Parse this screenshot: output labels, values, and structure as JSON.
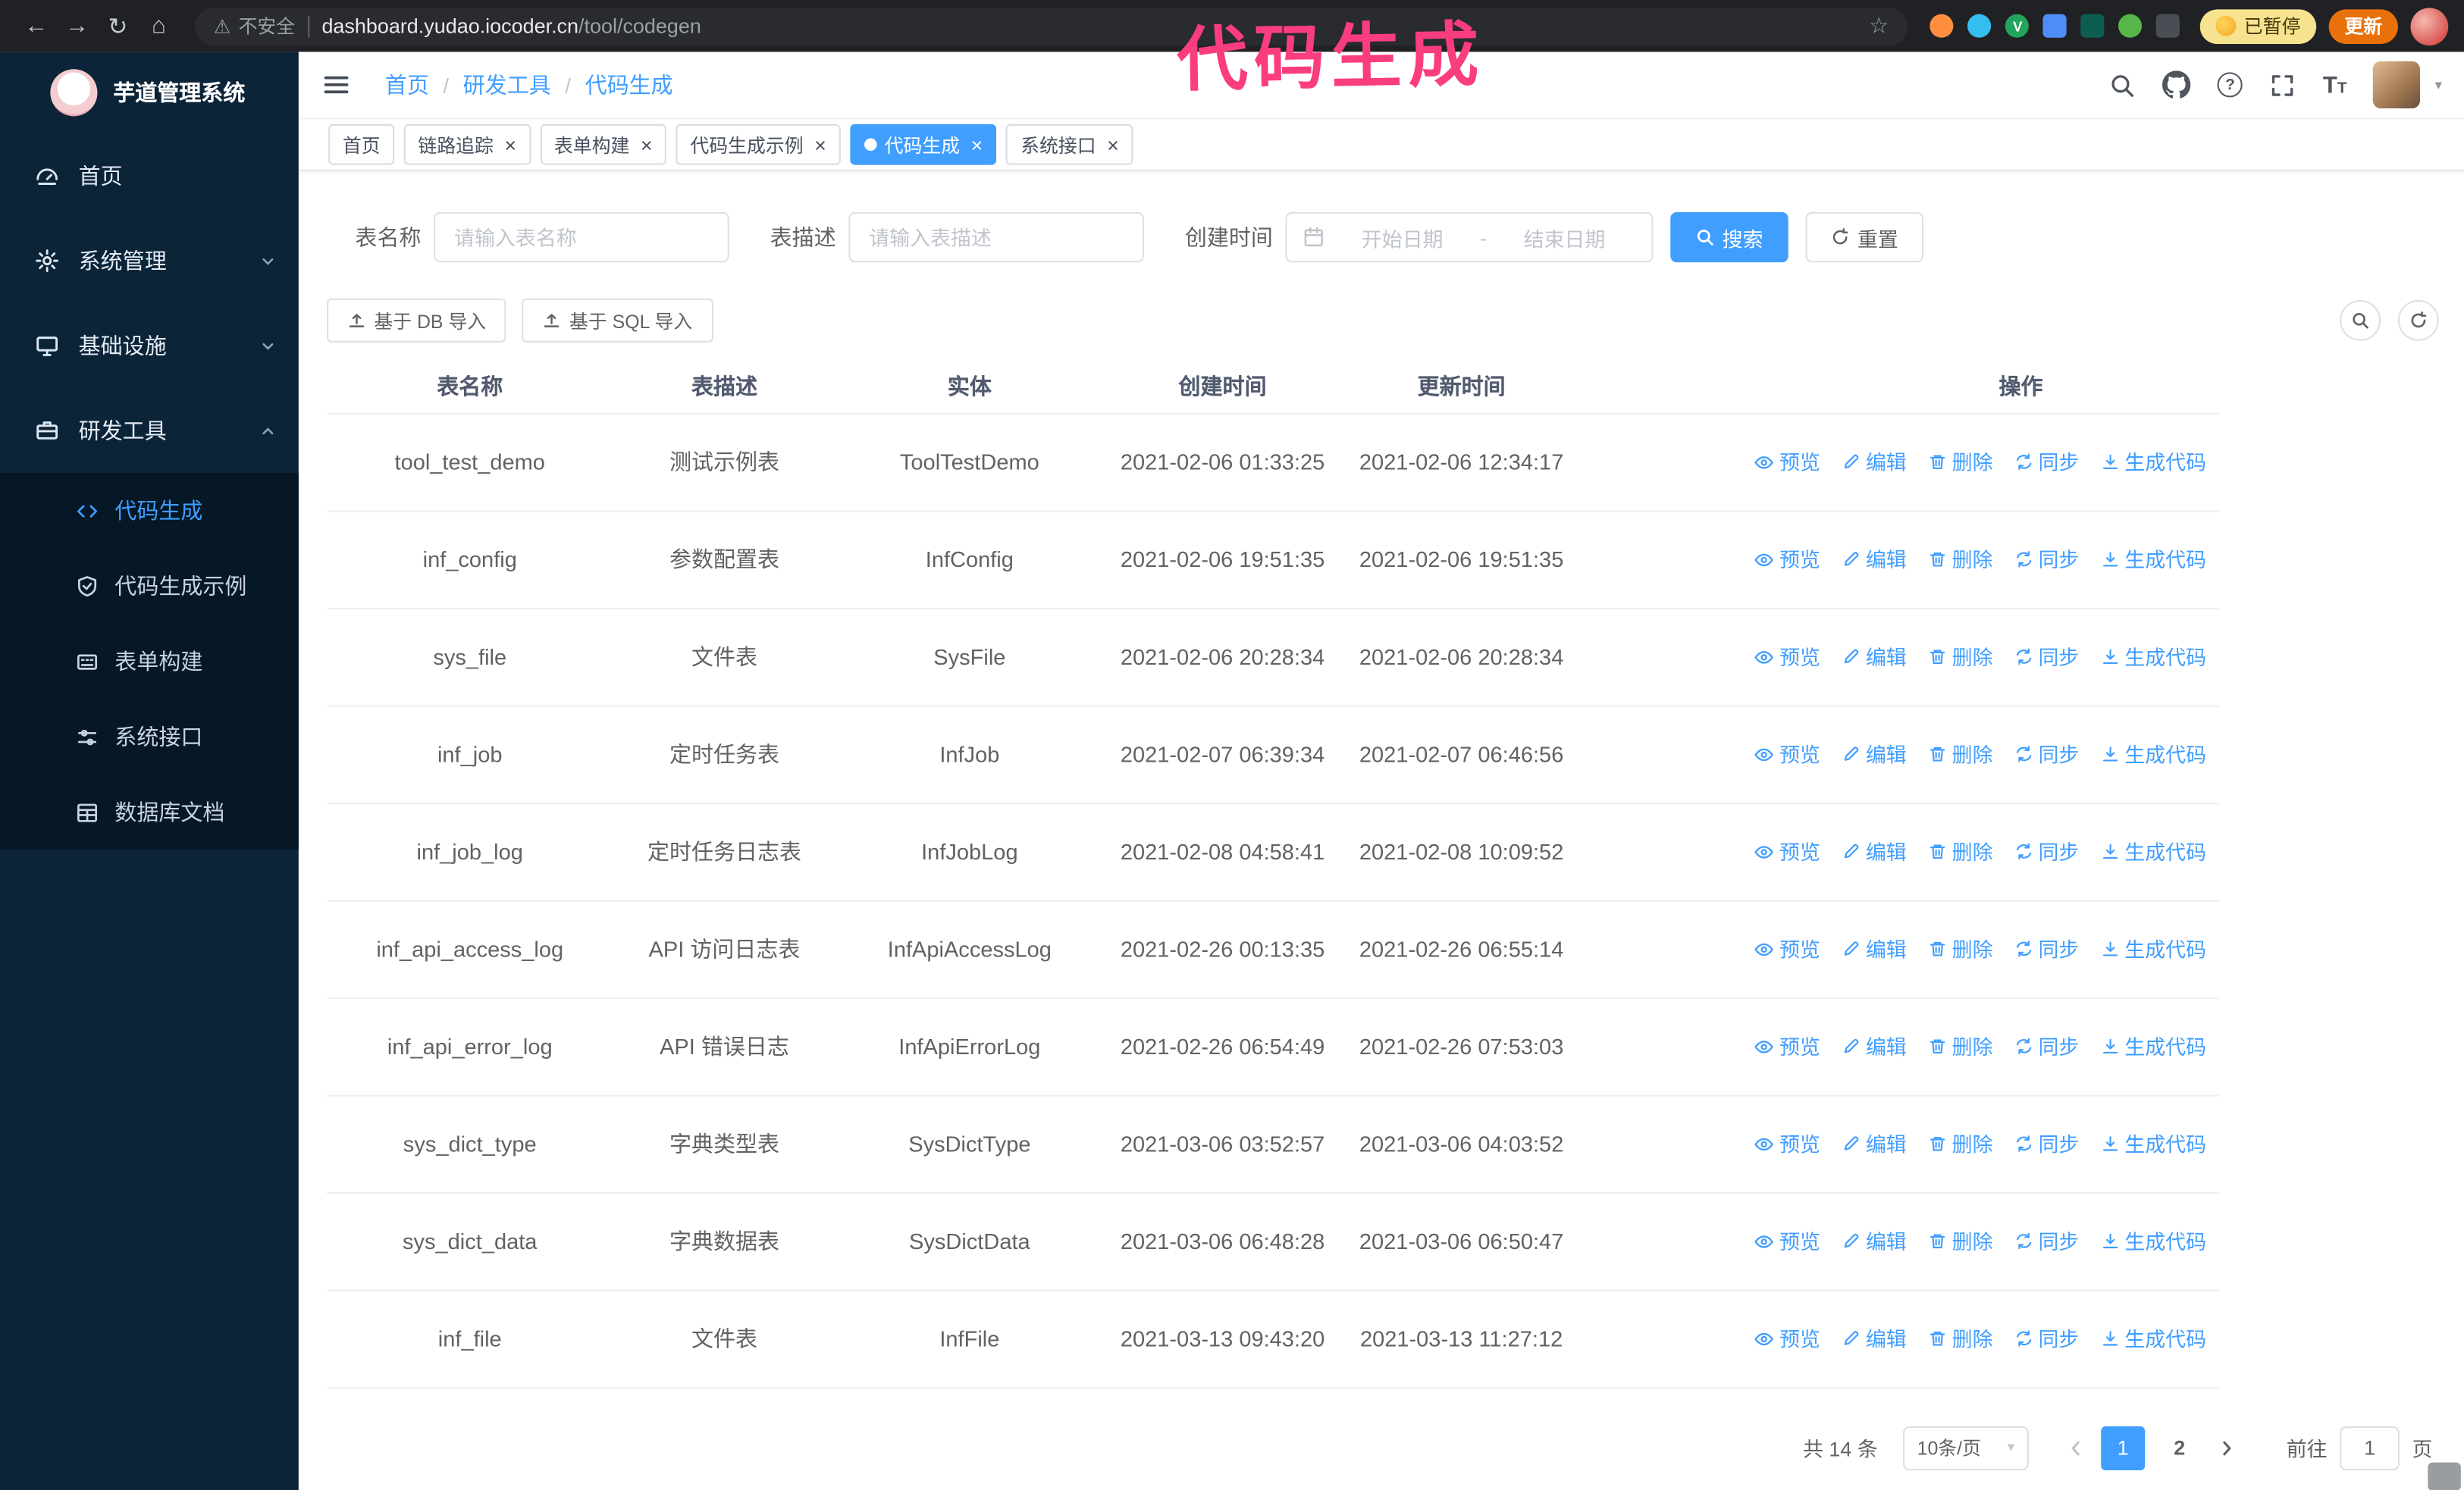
{
  "annotation": {
    "text": "代码生成",
    "color": "#fa3d7f"
  },
  "browser": {
    "security_label": "不安全",
    "url_host": "dashboard.yudao.iocoder.cn",
    "url_path": "/tool/codegen",
    "paused_badge": "已暂停",
    "update_button": "更新"
  },
  "sidebar": {
    "logo_title": "芋道管理系统",
    "items": [
      {
        "label": "首页"
      },
      {
        "label": "系统管理"
      },
      {
        "label": "基础设施"
      },
      {
        "label": "研发工具"
      }
    ],
    "subitems": [
      {
        "label": "代码生成",
        "active": true
      },
      {
        "label": "代码生成示例"
      },
      {
        "label": "表单构建"
      },
      {
        "label": "系统接口"
      },
      {
        "label": "数据库文档"
      }
    ]
  },
  "breadcrumb": {
    "items": [
      "首页",
      "研发工具",
      "代码生成"
    ]
  },
  "tabs": [
    {
      "label": "首页",
      "closable": false
    },
    {
      "label": "链路追踪",
      "closable": true
    },
    {
      "label": "表单构建",
      "closable": true
    },
    {
      "label": "代码生成示例",
      "closable": true
    },
    {
      "label": "代码生成",
      "closable": true,
      "active": true
    },
    {
      "label": "系统接口",
      "closable": true
    }
  ],
  "filters": {
    "table_name_label": "表名称",
    "table_name_placeholder": "请输入表名称",
    "table_desc_label": "表描述",
    "table_desc_placeholder": "请输入表描述",
    "create_time_label": "创建时间",
    "date_start_placeholder": "开始日期",
    "date_separator": "-",
    "date_end_placeholder": "结束日期",
    "search_button": "搜索",
    "reset_button": "重置"
  },
  "toolbar": {
    "import_db": "基于 DB 导入",
    "import_sql": "基于 SQL 导入"
  },
  "table": {
    "columns": [
      "表名称",
      "表描述",
      "实体",
      "创建时间",
      "更新时间",
      "操作"
    ],
    "actions": {
      "preview": "预览",
      "edit": "编辑",
      "delete": "删除",
      "sync": "同步",
      "generate": "生成代码"
    },
    "rows": [
      {
        "name": "tool_test_demo",
        "desc": "测试示例表",
        "entity": "ToolTestDemo",
        "created": "2021-02-06 01:33:25",
        "updated": "2021-02-06 12:34:17"
      },
      {
        "name": "inf_config",
        "desc": "参数配置表",
        "entity": "InfConfig",
        "created": "2021-02-06 19:51:35",
        "updated": "2021-02-06 19:51:35"
      },
      {
        "name": "sys_file",
        "desc": "文件表",
        "entity": "SysFile",
        "created": "2021-02-06 20:28:34",
        "updated": "2021-02-06 20:28:34"
      },
      {
        "name": "inf_job",
        "desc": "定时任务表",
        "entity": "InfJob",
        "created": "2021-02-07 06:39:34",
        "updated": "2021-02-07 06:46:56"
      },
      {
        "name": "inf_job_log",
        "desc": "定时任务日志表",
        "entity": "InfJobLog",
        "created": "2021-02-08 04:58:41",
        "updated": "2021-02-08 10:09:52"
      },
      {
        "name": "inf_api_access_log",
        "desc": "API 访问日志表",
        "entity": "InfApiAccessLog",
        "created": "2021-02-26 00:13:35",
        "updated": "2021-02-26 06:55:14"
      },
      {
        "name": "inf_api_error_log",
        "desc": "API 错误日志",
        "entity": "InfApiErrorLog",
        "created": "2021-02-26 06:54:49",
        "updated": "2021-02-26 07:53:03"
      },
      {
        "name": "sys_dict_type",
        "desc": "字典类型表",
        "entity": "SysDictType",
        "created": "2021-03-06 03:52:57",
        "updated": "2021-03-06 04:03:52"
      },
      {
        "name": "sys_dict_data",
        "desc": "字典数据表",
        "entity": "SysDictData",
        "created": "2021-03-06 06:48:28",
        "updated": "2021-03-06 06:50:47"
      },
      {
        "name": "inf_file",
        "desc": "文件表",
        "entity": "InfFile",
        "created": "2021-03-13 09:43:20",
        "updated": "2021-03-13 11:27:12"
      }
    ]
  },
  "pagination": {
    "total_text": "共 14 条",
    "page_size": "10条/页",
    "pages": [
      "1",
      "2"
    ],
    "active_page": "1",
    "goto_label": "前往",
    "goto_value": "1",
    "page_label": "页"
  },
  "colors": {
    "accent": "#409eff",
    "sidebar_bg": "#0c2438",
    "annotation": "#fa3d7f"
  }
}
